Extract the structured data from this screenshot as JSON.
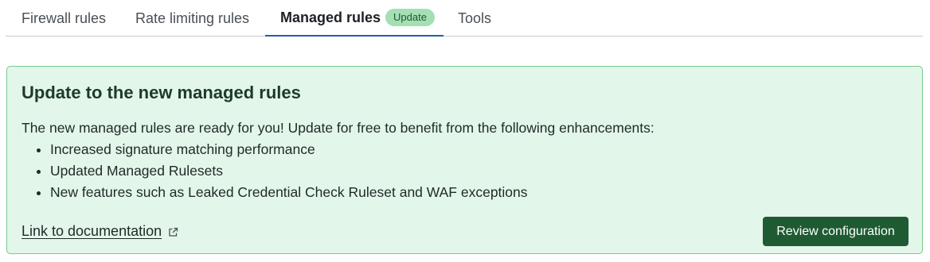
{
  "tabs": [
    {
      "label": "Firewall rules"
    },
    {
      "label": "Rate limiting rules"
    },
    {
      "label": "Managed rules",
      "badge": "Update",
      "active": true
    },
    {
      "label": "Tools"
    }
  ],
  "banner": {
    "title": "Update to the new managed rules",
    "description": "The new managed rules are ready for you! Update for free to benefit from the following enhancements:",
    "items": [
      "Increased signature matching performance",
      "Updated Managed Rulesets",
      "New features such as Leaked Credential Check Ruleset and WAF exceptions"
    ],
    "doc_link_label": "Link to documentation",
    "doc_link_icon": "external-link-icon",
    "review_button_label": "Review configuration"
  },
  "colors": {
    "banner_background": "#e3f6ea",
    "banner_border": "#76cb8d",
    "badge_background": "#a5dfb4",
    "primary_button": "#1f5b32",
    "active_tab_underline": "#1f5eab"
  }
}
